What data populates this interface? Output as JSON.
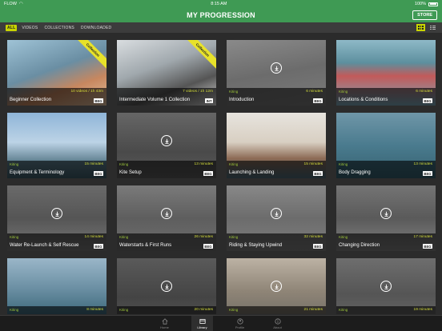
{
  "status": {
    "carrier": "FLOW",
    "time": "8:15 AM",
    "battery": "100%"
  },
  "nav": {
    "title": "MY PROGRESSION",
    "store_label": "STORE"
  },
  "filters": [
    "ALL",
    "VIDEOS",
    "COLLECTIONS",
    "DOWNLOADED"
  ],
  "colors": {
    "brand_green": "#3f9a54",
    "accent_yellow": "#c8d400"
  },
  "cards": [
    {
      "title": "Beginner Collection",
      "category": "",
      "duration": "10 videos / 1h 43m",
      "level": "BEG",
      "ribbon": "Collection",
      "download": false
    },
    {
      "title": "Intermediate Volume 1 Collection",
      "category": "",
      "duration": "7 videos / 1h 12m",
      "level": "INT",
      "ribbon": "Collection",
      "download": false
    },
    {
      "title": "Introduction",
      "category": "Kiting",
      "duration": "6 minutes",
      "level": "BEG",
      "ribbon": "",
      "download": true
    },
    {
      "title": "Locations & Conditions",
      "category": "Kiting",
      "duration": "6 minutes",
      "level": "BEG",
      "ribbon": "",
      "download": false
    },
    {
      "title": "Equipment & Terminology",
      "category": "Kiting",
      "duration": "15 minutes",
      "level": "BEG",
      "ribbon": "",
      "download": false
    },
    {
      "title": "Kite Setup",
      "category": "Kiting",
      "duration": "13 minutes",
      "level": "BEG",
      "ribbon": "",
      "download": true
    },
    {
      "title": "Launching & Landing",
      "category": "Kiting",
      "duration": "15 minutes",
      "level": "BEG",
      "ribbon": "",
      "download": false
    },
    {
      "title": "Body Dragging",
      "category": "Kiting",
      "duration": "13 minutes",
      "level": "BEG",
      "ribbon": "",
      "download": false
    },
    {
      "title": "Water Re-Launch & Self Rescue",
      "category": "Kiting",
      "duration": "14 minutes",
      "level": "BEG",
      "ribbon": "",
      "download": true
    },
    {
      "title": "Waterstarts & First Runs",
      "category": "Kiting",
      "duration": "26 minutes",
      "level": "BEG",
      "ribbon": "",
      "download": true
    },
    {
      "title": "Riding & Staying Upwind",
      "category": "Kiting",
      "duration": "32 minutes",
      "level": "BEG",
      "ribbon": "",
      "download": true
    },
    {
      "title": "Changing Direction",
      "category": "Kiting",
      "duration": "17 minutes",
      "level": "BEG",
      "ribbon": "",
      "download": true
    },
    {
      "title": "",
      "category": "Kiting",
      "duration": "8 minutes",
      "level": "",
      "ribbon": "",
      "download": false
    },
    {
      "title": "",
      "category": "Kiting",
      "duration": "20 minutes",
      "level": "",
      "ribbon": "",
      "download": true
    },
    {
      "title": "",
      "category": "Kiting",
      "duration": "21 minutes",
      "level": "",
      "ribbon": "",
      "download": true
    },
    {
      "title": "",
      "category": "Kiting",
      "duration": "19 minutes",
      "level": "",
      "ribbon": "",
      "download": true
    }
  ],
  "tabs": [
    {
      "label": "Home",
      "icon": "home-icon"
    },
    {
      "label": "Library",
      "icon": "library-icon"
    },
    {
      "label": "Profile",
      "icon": "profile-icon"
    },
    {
      "label": "About",
      "icon": "info-icon"
    }
  ]
}
